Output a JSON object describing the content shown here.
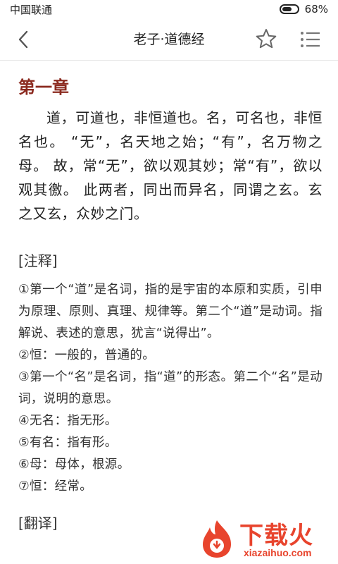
{
  "status": {
    "carrier": "中国联通",
    "battery_percent": "68%",
    "battery_level": 0.68
  },
  "navbar": {
    "title": "老子·道德经",
    "back_icon": "chevron-left-icon",
    "star_icon": "star-outline-icon",
    "menu_icon": "list-icon"
  },
  "chapter": {
    "title": "第一章",
    "text": "道，可道也，非恒道也。名，可名也，非恒名也。 “无”，名天地之始；“有”，名万物之母。 故，常“无”，欲以观其妙；常“有”，欲以观其徼。 此两者，同出而异名，同谓之玄。玄之又玄，众妙之门。"
  },
  "notes_heading": "[注释]",
  "notes": [
    "①第一个“道”是名词，指的是宇宙的本原和实质，引申为原理、原则、真理、规律等。第二个“道”是动词。指解说、表述的意思，犹言“说得出”。",
    "②恒：一般的，普通的。",
    "③第一个“名”是名词，指“道”的形态。第二个“名”是动词，说明的意思。",
    "④无名：指无形。",
    "⑤有名：指有形。",
    "⑥母：母体，根源。",
    "⑦恒：经常。"
  ],
  "translation_heading": "[翻译]",
  "watermark": {
    "brand": "下载火",
    "url": "xiazaihuo.com"
  },
  "colors": {
    "accent": "#8b2a1f",
    "watermark": "#e8442d"
  }
}
